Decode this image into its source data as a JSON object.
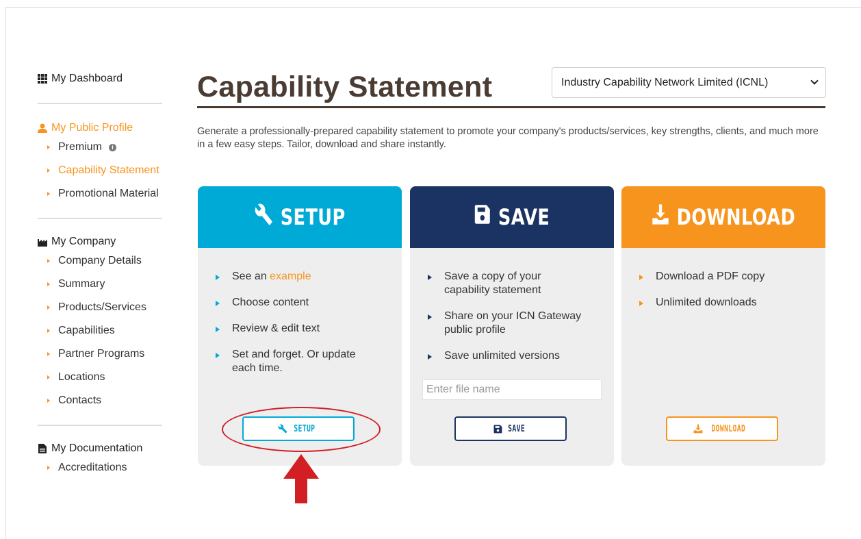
{
  "sidebar": {
    "dashboard": "My Dashboard",
    "public_profile": {
      "label": "My Public Profile",
      "items": [
        "Premium",
        "Capability Statement",
        "Promotional Material"
      ]
    },
    "company": {
      "label": "My Company",
      "items": [
        "Company Details",
        "Summary",
        "Products/Services",
        "Capabilities",
        "Partner Programs",
        "Locations",
        "Contacts"
      ]
    },
    "documentation": {
      "label": "My Documentation",
      "items": [
        "Accreditations"
      ]
    }
  },
  "header": {
    "title": "Capability Statement",
    "company_selected": "Industry Capability Network Limited (ICNL)"
  },
  "intro": "Generate a professionally-prepared capability statement to promote your company's products/services, key strengths, clients, and much more in a few easy steps. Tailor, download and share instantly.",
  "cards": {
    "setup": {
      "title": "SETUP",
      "bullet1_prefix": "See an ",
      "bullet1_link": "example",
      "bullet2": "Choose content",
      "bullet3": "Review & edit text",
      "bullet4": "Set and forget. Or update each time.",
      "button": "SETUP"
    },
    "save": {
      "title": "SAVE",
      "bullet1": "Save a copy of your capability statement",
      "bullet2": "Share on your ICN Gateway public profile",
      "bullet3": "Save unlimited versions",
      "file_placeholder": "Enter file name",
      "button": "SAVE"
    },
    "download": {
      "title": "DOWNLOAD",
      "bullet1": "Download a PDF copy",
      "bullet2": "Unlimited downloads",
      "button": "DOWNLOAD"
    }
  },
  "colors": {
    "setup": "#00aad6",
    "save": "#1b3363",
    "download": "#f7941d",
    "annotation": "#d11f24"
  },
  "icons": [
    "grid-icon",
    "user-icon",
    "info-icon",
    "factory-icon",
    "document-icon",
    "wrench-icon",
    "floppy-disk-icon",
    "download-icon",
    "chevron-down-icon"
  ]
}
